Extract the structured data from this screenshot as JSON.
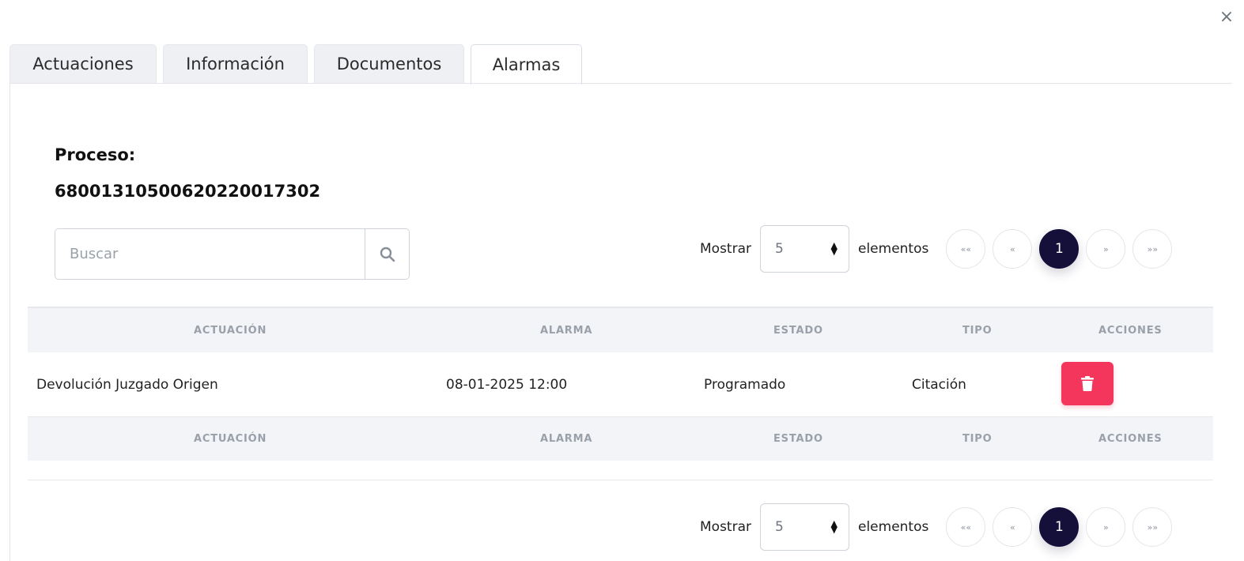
{
  "modal": {
    "close_symbol": "×"
  },
  "tabs": [
    {
      "label": "Actuaciones",
      "active": false
    },
    {
      "label": "Información",
      "active": false
    },
    {
      "label": "Documentos",
      "active": false
    },
    {
      "label": "Alarmas",
      "active": true
    }
  ],
  "proceso": {
    "label": "Proceso:",
    "number": "68001310500620220017302"
  },
  "search": {
    "placeholder": "Buscar",
    "value": "",
    "icon": "search-icon"
  },
  "pagination": {
    "show_label": "Mostrar",
    "page_size": "5",
    "items_label": "elementos",
    "first": "««",
    "prev": "«",
    "current": "1",
    "next": "»",
    "last": "»»"
  },
  "table": {
    "columns": [
      "ACTUACIÓN",
      "ALARMA",
      "ESTADO",
      "TIPO",
      "ACCIONES"
    ],
    "rows": [
      {
        "actuacion": "Devolución Juzgado Origen",
        "alarma": "08-01-2025 12:00",
        "estado": "Programado",
        "tipo": "Citación",
        "action_icon": "trash-icon"
      }
    ]
  },
  "colors": {
    "danger": "#f5365c",
    "page_active": "#15103a"
  }
}
